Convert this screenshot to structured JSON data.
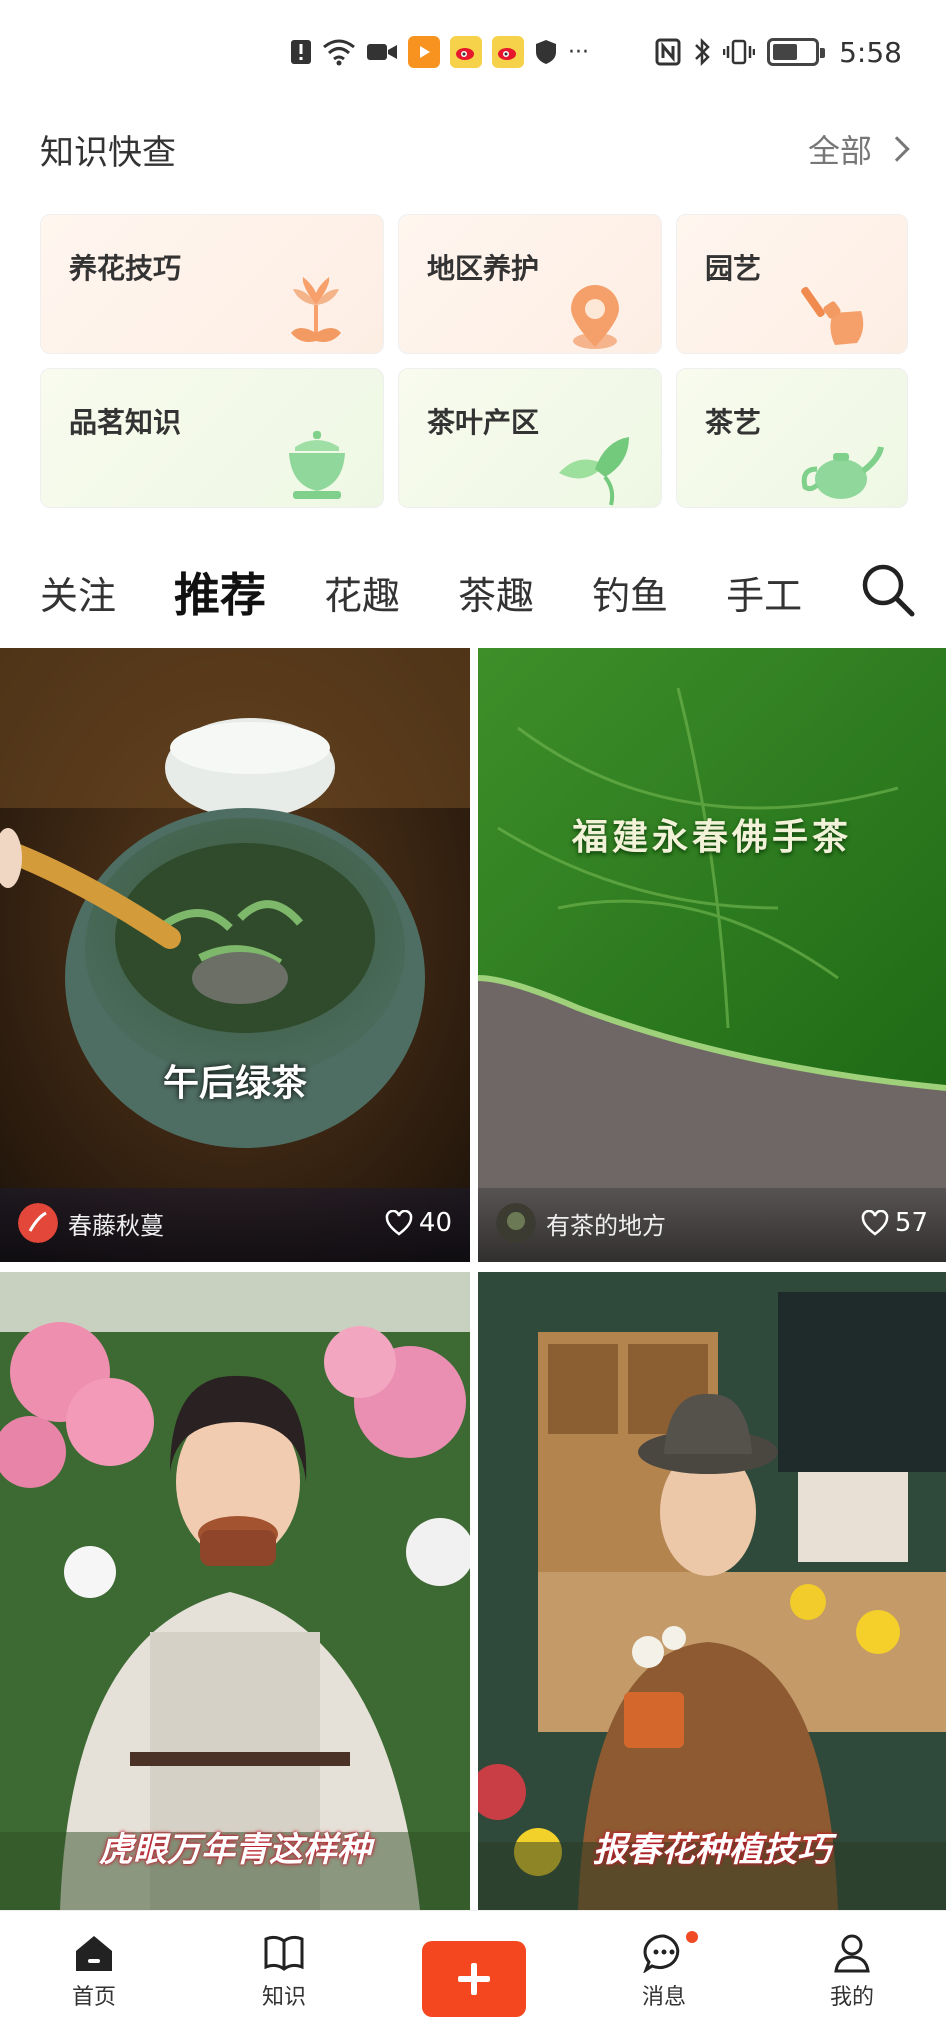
{
  "status_bar": {
    "time": "5:58",
    "more": "···"
  },
  "knowledge": {
    "title": "知识快查",
    "all_label": "全部",
    "cards": [
      {
        "label": "养花技巧",
        "icon": "flower-icon"
      },
      {
        "label": "地区养护",
        "icon": "location-pin-icon"
      },
      {
        "label": "园艺",
        "icon": "shovel-icon"
      },
      {
        "label": "品茗知识",
        "icon": "tea-bowl-icon"
      },
      {
        "label": "茶叶产区",
        "icon": "tea-leaf-icon"
      },
      {
        "label": "茶艺",
        "icon": "teapot-icon"
      }
    ]
  },
  "tabs": [
    "关注",
    "推荐",
    "花趣",
    "茶趣",
    "钓鱼",
    "手工"
  ],
  "active_tab": "推荐",
  "feed": [
    {
      "caption": "午后绿茶",
      "author": "春藤秋蔓",
      "likes": "40"
    },
    {
      "caption": "福建永春佛手茶",
      "author": "有茶的地方",
      "likes": "57"
    },
    {
      "caption": "虎眼万年青这样种"
    },
    {
      "caption": "报春花种植技巧"
    }
  ],
  "nav": {
    "home": "首页",
    "knowledge": "知识",
    "messages": "消息",
    "mine": "我的"
  },
  "colors": {
    "accent": "#f5471f",
    "text": "#333333"
  }
}
